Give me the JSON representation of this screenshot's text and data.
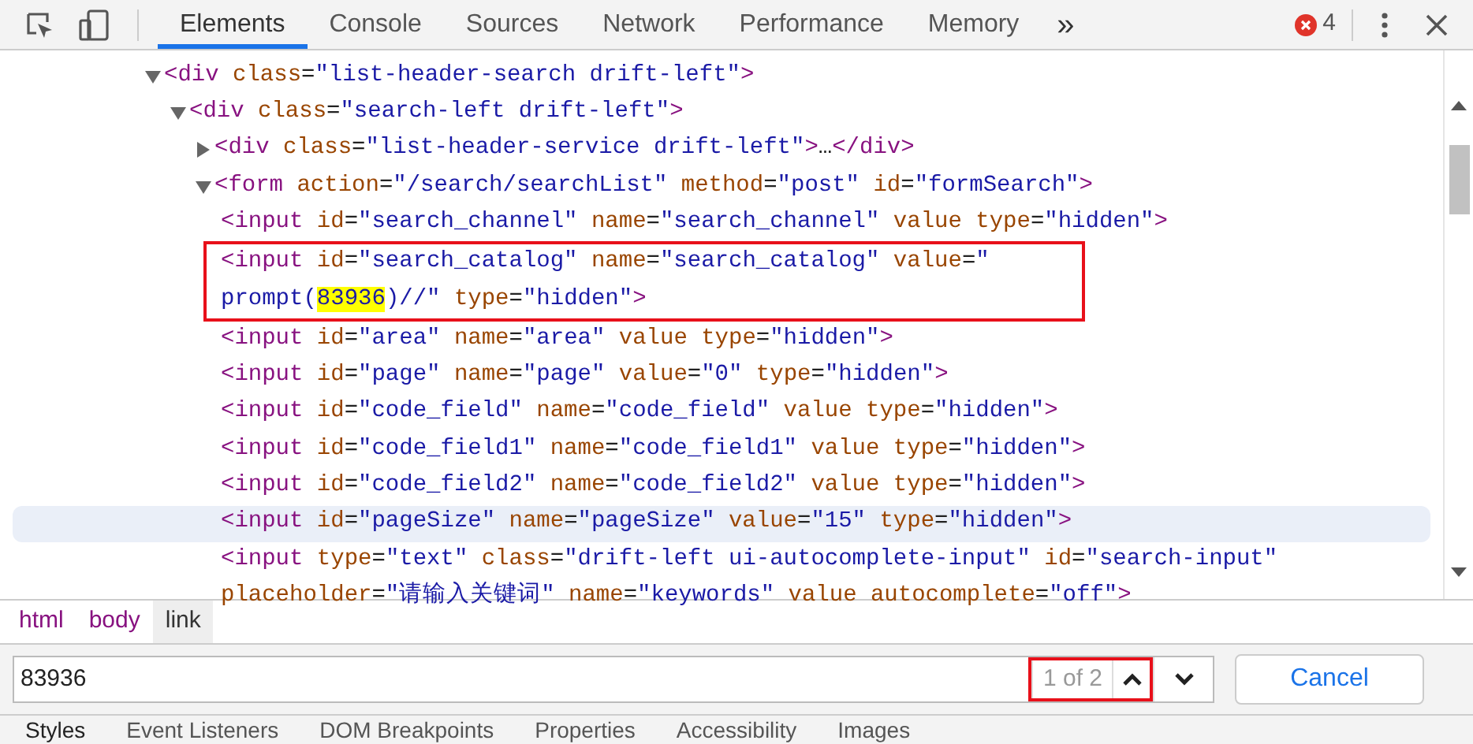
{
  "toolbar": {
    "tabs": [
      {
        "label": "Elements",
        "selected": true
      },
      {
        "label": "Console",
        "selected": false
      },
      {
        "label": "Sources",
        "selected": false
      },
      {
        "label": "Network",
        "selected": false
      },
      {
        "label": "Performance",
        "selected": false
      },
      {
        "label": "Memory",
        "selected": false
      }
    ],
    "overflow": "»",
    "error_count": "4"
  },
  "dom_tree": [
    {
      "expanded": true,
      "lines": [
        [
          {
            "kind": "tag",
            "text": "<div"
          },
          {
            "kind": "attr",
            "text": " class"
          },
          {
            "kind": "eq",
            "text": "="
          },
          {
            "kind": "value",
            "text": "\"list-header-search drift-left\""
          },
          {
            "kind": "tag",
            "text": ">"
          }
        ]
      ],
      "children": [
        {
          "expanded": true,
          "lines": [
            [
              {
                "kind": "tag",
                "text": "<div"
              },
              {
                "kind": "attr",
                "text": " class"
              },
              {
                "kind": "eq",
                "text": "="
              },
              {
                "kind": "value",
                "text": "\"search-left drift-left\""
              },
              {
                "kind": "tag",
                "text": ">"
              }
            ]
          ],
          "children": [
            {
              "expanded": false,
              "lines": [
                [
                  {
                    "kind": "tag",
                    "text": "<div"
                  },
                  {
                    "kind": "attr",
                    "text": " class"
                  },
                  {
                    "kind": "eq",
                    "text": "="
                  },
                  {
                    "kind": "value",
                    "text": "\"list-header-service drift-left\""
                  },
                  {
                    "kind": "tag",
                    "text": ">"
                  },
                  {
                    "kind": "plain",
                    "text": "…"
                  },
                  {
                    "kind": "tag",
                    "text": "</div>"
                  }
                ]
              ]
            },
            {
              "expanded": true,
              "lines": [
                [
                  {
                    "kind": "tag",
                    "text": "<form"
                  },
                  {
                    "kind": "attr",
                    "text": " action"
                  },
                  {
                    "kind": "eq",
                    "text": "="
                  },
                  {
                    "kind": "value",
                    "text": "\"/search/searchList\""
                  },
                  {
                    "kind": "attr",
                    "text": " method"
                  },
                  {
                    "kind": "eq",
                    "text": "="
                  },
                  {
                    "kind": "value",
                    "text": "\"post\""
                  },
                  {
                    "kind": "attr",
                    "text": " id"
                  },
                  {
                    "kind": "eq",
                    "text": "="
                  },
                  {
                    "kind": "value",
                    "text": "\"formSearch\""
                  },
                  {
                    "kind": "tag",
                    "text": ">"
                  }
                ]
              ],
              "children": [
                {
                  "lines": [
                    [
                      {
                        "kind": "tag",
                        "text": "<input"
                      },
                      {
                        "kind": "attr",
                        "text": " id"
                      },
                      {
                        "kind": "eq",
                        "text": "="
                      },
                      {
                        "kind": "value",
                        "text": "\"search_channel\""
                      },
                      {
                        "kind": "attr",
                        "text": " name"
                      },
                      {
                        "kind": "eq",
                        "text": "="
                      },
                      {
                        "kind": "value",
                        "text": "\"search_channel\""
                      },
                      {
                        "kind": "attr",
                        "text": " value type"
                      },
                      {
                        "kind": "eq",
                        "text": "="
                      },
                      {
                        "kind": "value",
                        "text": "\"hidden\""
                      },
                      {
                        "kind": "tag",
                        "text": ">"
                      }
                    ]
                  ]
                },
                {
                  "boxed": true,
                  "lines": [
                    [
                      {
                        "kind": "tag",
                        "text": "<input"
                      },
                      {
                        "kind": "attr",
                        "text": " id"
                      },
                      {
                        "kind": "eq",
                        "text": "="
                      },
                      {
                        "kind": "value",
                        "text": "\"search_catalog\""
                      },
                      {
                        "kind": "attr",
                        "text": " name"
                      },
                      {
                        "kind": "eq",
                        "text": "="
                      },
                      {
                        "kind": "value",
                        "text": "\"search_catalog\""
                      },
                      {
                        "kind": "attr",
                        "text": " value"
                      },
                      {
                        "kind": "eq",
                        "text": "="
                      },
                      {
                        "kind": "value",
                        "text": "\""
                      }
                    ],
                    [
                      {
                        "kind": "value",
                        "text": "prompt("
                      },
                      {
                        "kind": "match",
                        "text": "83936"
                      },
                      {
                        "kind": "value",
                        "text": ")//\""
                      },
                      {
                        "kind": "attr",
                        "text": " type"
                      },
                      {
                        "kind": "eq",
                        "text": "="
                      },
                      {
                        "kind": "value",
                        "text": "\"hidden\""
                      },
                      {
                        "kind": "tag",
                        "text": ">"
                      }
                    ]
                  ]
                },
                {
                  "lines": [
                    [
                      {
                        "kind": "tag",
                        "text": "<input"
                      },
                      {
                        "kind": "attr",
                        "text": " id"
                      },
                      {
                        "kind": "eq",
                        "text": "="
                      },
                      {
                        "kind": "value",
                        "text": "\"area\""
                      },
                      {
                        "kind": "attr",
                        "text": " name"
                      },
                      {
                        "kind": "eq",
                        "text": "="
                      },
                      {
                        "kind": "value",
                        "text": "\"area\""
                      },
                      {
                        "kind": "attr",
                        "text": " value type"
                      },
                      {
                        "kind": "eq",
                        "text": "="
                      },
                      {
                        "kind": "value",
                        "text": "\"hidden\""
                      },
                      {
                        "kind": "tag",
                        "text": ">"
                      }
                    ]
                  ]
                },
                {
                  "lines": [
                    [
                      {
                        "kind": "tag",
                        "text": "<input"
                      },
                      {
                        "kind": "attr",
                        "text": " id"
                      },
                      {
                        "kind": "eq",
                        "text": "="
                      },
                      {
                        "kind": "value",
                        "text": "\"page\""
                      },
                      {
                        "kind": "attr",
                        "text": " name"
                      },
                      {
                        "kind": "eq",
                        "text": "="
                      },
                      {
                        "kind": "value",
                        "text": "\"page\""
                      },
                      {
                        "kind": "attr",
                        "text": " value"
                      },
                      {
                        "kind": "eq",
                        "text": "="
                      },
                      {
                        "kind": "value",
                        "text": "\"0\""
                      },
                      {
                        "kind": "attr",
                        "text": " type"
                      },
                      {
                        "kind": "eq",
                        "text": "="
                      },
                      {
                        "kind": "value",
                        "text": "\"hidden\""
                      },
                      {
                        "kind": "tag",
                        "text": ">"
                      }
                    ]
                  ]
                },
                {
                  "lines": [
                    [
                      {
                        "kind": "tag",
                        "text": "<input"
                      },
                      {
                        "kind": "attr",
                        "text": " id"
                      },
                      {
                        "kind": "eq",
                        "text": "="
                      },
                      {
                        "kind": "value",
                        "text": "\"code_field\""
                      },
                      {
                        "kind": "attr",
                        "text": " name"
                      },
                      {
                        "kind": "eq",
                        "text": "="
                      },
                      {
                        "kind": "value",
                        "text": "\"code_field\""
                      },
                      {
                        "kind": "attr",
                        "text": " value type"
                      },
                      {
                        "kind": "eq",
                        "text": "="
                      },
                      {
                        "kind": "value",
                        "text": "\"hidden\""
                      },
                      {
                        "kind": "tag",
                        "text": ">"
                      }
                    ]
                  ]
                },
                {
                  "lines": [
                    [
                      {
                        "kind": "tag",
                        "text": "<input"
                      },
                      {
                        "kind": "attr",
                        "text": " id"
                      },
                      {
                        "kind": "eq",
                        "text": "="
                      },
                      {
                        "kind": "value",
                        "text": "\"code_field1\""
                      },
                      {
                        "kind": "attr",
                        "text": " name"
                      },
                      {
                        "kind": "eq",
                        "text": "="
                      },
                      {
                        "kind": "value",
                        "text": "\"code_field1\""
                      },
                      {
                        "kind": "attr",
                        "text": " value type"
                      },
                      {
                        "kind": "eq",
                        "text": "="
                      },
                      {
                        "kind": "value",
                        "text": "\"hidden\""
                      },
                      {
                        "kind": "tag",
                        "text": ">"
                      }
                    ]
                  ]
                },
                {
                  "lines": [
                    [
                      {
                        "kind": "tag",
                        "text": "<input"
                      },
                      {
                        "kind": "attr",
                        "text": " id"
                      },
                      {
                        "kind": "eq",
                        "text": "="
                      },
                      {
                        "kind": "value",
                        "text": "\"code_field2\""
                      },
                      {
                        "kind": "attr",
                        "text": " name"
                      },
                      {
                        "kind": "eq",
                        "text": "="
                      },
                      {
                        "kind": "value",
                        "text": "\"code_field2\""
                      },
                      {
                        "kind": "attr",
                        "text": " value type"
                      },
                      {
                        "kind": "eq",
                        "text": "="
                      },
                      {
                        "kind": "value",
                        "text": "\"hidden\""
                      },
                      {
                        "kind": "tag",
                        "text": ">"
                      }
                    ]
                  ]
                },
                {
                  "hovered": true,
                  "lines": [
                    [
                      {
                        "kind": "tag",
                        "text": "<input"
                      },
                      {
                        "kind": "attr",
                        "text": " id"
                      },
                      {
                        "kind": "eq",
                        "text": "="
                      },
                      {
                        "kind": "value",
                        "text": "\"pageSize\""
                      },
                      {
                        "kind": "attr",
                        "text": " name"
                      },
                      {
                        "kind": "eq",
                        "text": "="
                      },
                      {
                        "kind": "value",
                        "text": "\"pageSize\""
                      },
                      {
                        "kind": "attr",
                        "text": " value"
                      },
                      {
                        "kind": "eq",
                        "text": "="
                      },
                      {
                        "kind": "value",
                        "text": "\"15\""
                      },
                      {
                        "kind": "attr",
                        "text": " type"
                      },
                      {
                        "kind": "eq",
                        "text": "="
                      },
                      {
                        "kind": "value",
                        "text": "\"hidden\""
                      },
                      {
                        "kind": "tag",
                        "text": ">"
                      }
                    ]
                  ]
                },
                {
                  "lines": [
                    [
                      {
                        "kind": "tag",
                        "text": "<input"
                      },
                      {
                        "kind": "attr",
                        "text": " type"
                      },
                      {
                        "kind": "eq",
                        "text": "="
                      },
                      {
                        "kind": "value",
                        "text": "\"text\""
                      },
                      {
                        "kind": "attr",
                        "text": " class"
                      },
                      {
                        "kind": "eq",
                        "text": "="
                      },
                      {
                        "kind": "value",
                        "text": "\"drift-left ui-autocomplete-input\""
                      },
                      {
                        "kind": "attr",
                        "text": " id"
                      },
                      {
                        "kind": "eq",
                        "text": "="
                      },
                      {
                        "kind": "value",
                        "text": "\"search-input\""
                      }
                    ],
                    [
                      {
                        "kind": "attr",
                        "text": "placeholder"
                      },
                      {
                        "kind": "eq",
                        "text": "="
                      },
                      {
                        "kind": "value",
                        "text": "\"请输入关键词\""
                      },
                      {
                        "kind": "attr",
                        "text": " name"
                      },
                      {
                        "kind": "eq",
                        "text": "="
                      },
                      {
                        "kind": "value",
                        "text": "\"keywords\""
                      },
                      {
                        "kind": "attr",
                        "text": " value autocomplete"
                      },
                      {
                        "kind": "eq",
                        "text": "="
                      },
                      {
                        "kind": "value",
                        "text": "\"off\""
                      },
                      {
                        "kind": "tag",
                        "text": ">"
                      }
                    ]
                  ]
                }
              ]
            }
          ]
        }
      ]
    }
  ],
  "breadcrumbs": [
    {
      "label": "html",
      "selected": false
    },
    {
      "label": "body",
      "selected": false
    },
    {
      "label": "link",
      "selected": true
    }
  ],
  "find_bar": {
    "value": "83936",
    "match_count": "1 of 2",
    "count_boxed": true,
    "cancel": "Cancel"
  },
  "bottom_tabs": [
    {
      "label": "Styles",
      "selected": true
    },
    {
      "label": "Event Listeners",
      "selected": false
    },
    {
      "label": "DOM Breakpoints",
      "selected": false
    },
    {
      "label": "Properties",
      "selected": false
    },
    {
      "label": "Accessibility",
      "selected": false
    },
    {
      "label": "Images",
      "selected": false
    }
  ]
}
